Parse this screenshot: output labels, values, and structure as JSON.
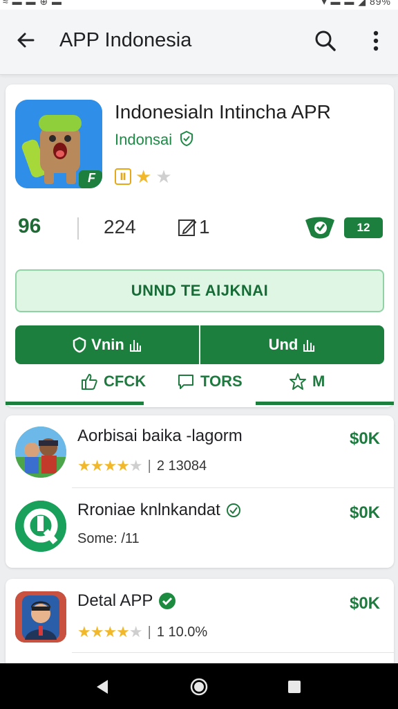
{
  "status_bar": {
    "left_text": "≈ ▬ ▬ ⊕ ▬",
    "right_text": "▾ ▬ ▬ ◢ 89%"
  },
  "app_bar": {
    "title": "APP Indonesia",
    "back_icon": "arrow-back-icon",
    "search_icon": "search-icon",
    "more_icon": "more-vert-icon"
  },
  "app": {
    "name": "Indonesialn Intincha APR",
    "developer": "Indonsai",
    "developer_icon": "verified-check-icon",
    "age_badge": "Ⅱ",
    "rating": 1.5,
    "rating_max": 3,
    "icon_corner_label": "F"
  },
  "stats": {
    "score": "96",
    "downloads": "224",
    "reviews": "1",
    "shield_icon": "shield-heart-icon",
    "badge": "12"
  },
  "buttons": {
    "install_label": "UNND TE AIJKNAI",
    "left_label": "Vnin",
    "right_label": "Und"
  },
  "actions": [
    {
      "label": "CFCK",
      "icon": "thumb-up-icon"
    },
    {
      "label": "TORS",
      "icon": "chat-bubble-icon"
    },
    {
      "label": "M",
      "icon": "star-outline-icon"
    }
  ],
  "list": [
    {
      "title": "Aorbisai baika -lagorm",
      "rating": 4,
      "sub": "2 13084",
      "price": "$0K"
    },
    {
      "title": "Rroniae knlnkandat",
      "title_icon": "verified-check-icon",
      "sub": "Some: /11",
      "price": "$0K"
    },
    {
      "title": "Detal APP",
      "title_icon": "verified-badge-icon",
      "rating": 4,
      "sub": "1 10.0%",
      "price": "$0K"
    }
  ],
  "colors": {
    "primary_green": "#1c7f3d",
    "light_green": "#def6e3",
    "star_yellow": "#f2b82c",
    "developer_green": "#1e8a46"
  },
  "nav": {
    "back_icon": "nav-back-icon",
    "home_icon": "nav-home-icon",
    "recents_icon": "nav-recents-icon"
  }
}
